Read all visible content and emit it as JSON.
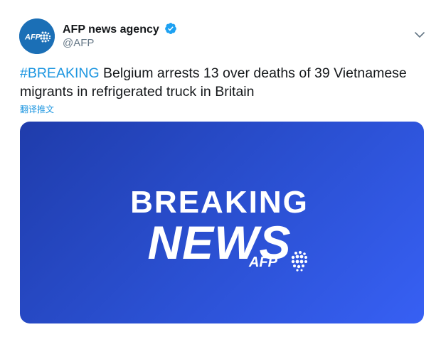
{
  "author": {
    "name": "AFP news agency",
    "handle": "@AFP",
    "avatar_text": "AFP"
  },
  "tweet": {
    "hashtag": "#BREAKING",
    "text": " Belgium arrests 13 over deaths of 39 Vietnamese migrants in refrigerated truck in Britain",
    "translate_label": "翻译推文"
  },
  "media": {
    "line1": "BREAKING",
    "line2": "NEWS",
    "logo_text": "AFP"
  },
  "icons": {
    "verified": "verified-badge-icon",
    "menu": "chevron-down-icon"
  },
  "colors": {
    "link": "#1b95e0",
    "avatar_bg": "#1b6fb6",
    "media_gradient_start": "#1f3cab",
    "media_gradient_end": "#3760f4"
  }
}
